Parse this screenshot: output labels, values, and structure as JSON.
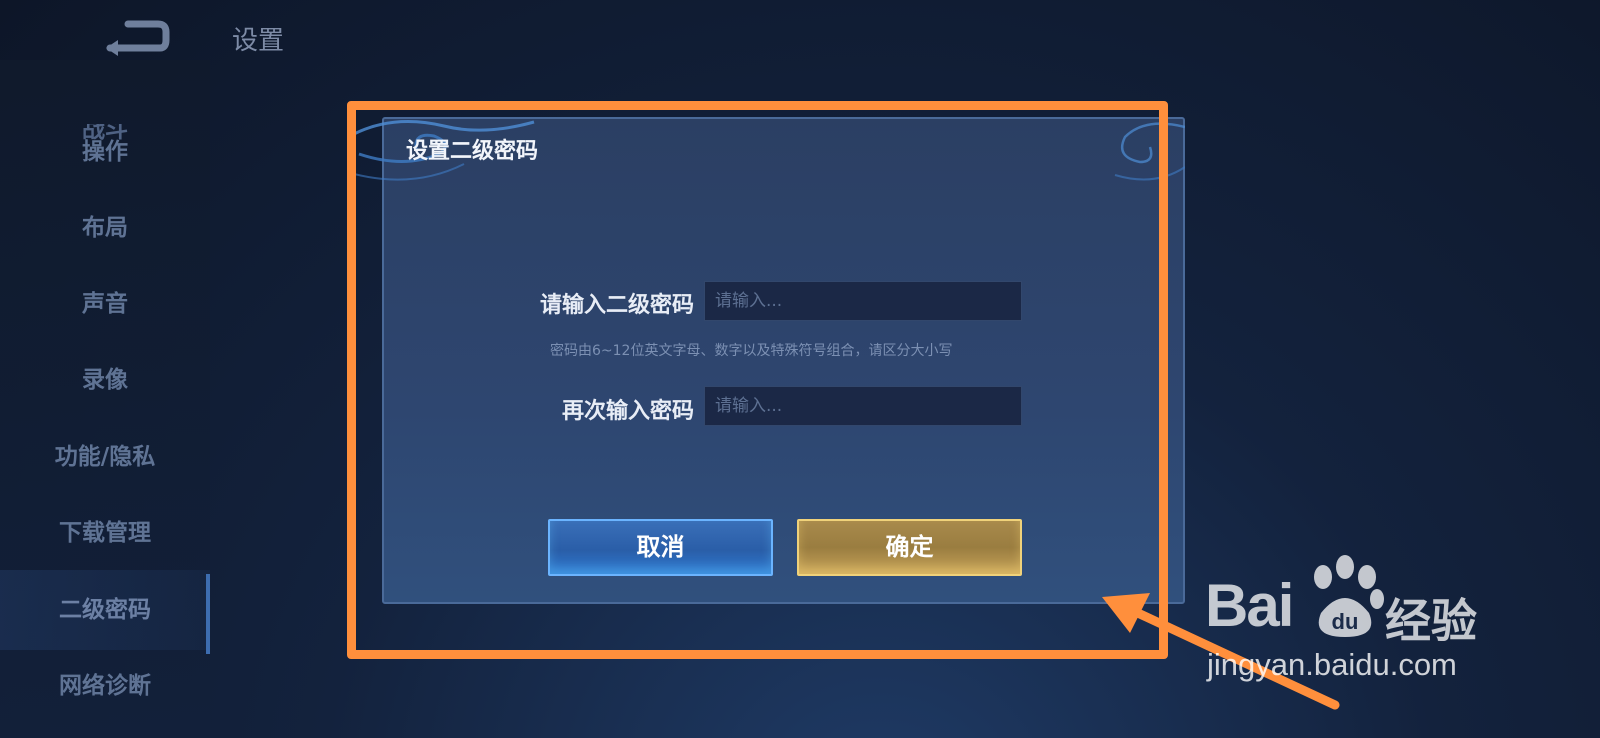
{
  "header": {
    "title": "设置"
  },
  "sidebar": {
    "cut_item": "战斗",
    "items": [
      {
        "label": "操作"
      },
      {
        "label": "布局"
      },
      {
        "label": "声音"
      },
      {
        "label": "录像"
      },
      {
        "label": "功能/隐私"
      },
      {
        "label": "下载管理"
      },
      {
        "label": "二级密码",
        "active": true
      },
      {
        "label": "网络诊断"
      }
    ]
  },
  "dialog": {
    "title": "设置二级密码",
    "password_label": "请输入二级密码",
    "password_placeholder": "请输入...",
    "hint": "密码由6~12位英文字母、数字以及特殊符号组合，请区分大小写",
    "confirm_label": "再次输入密码",
    "confirm_placeholder": "请输入...",
    "cancel_button": "取消",
    "ok_button": "确定"
  },
  "annotation": {
    "highlight_color": "#ff8f3c"
  },
  "watermark": {
    "logo_text": "Bai",
    "logo_du": "du",
    "jingyan": "经验",
    "url": "jingyan.baidu.com"
  },
  "colors": {
    "cancel_button": "#2f6cb8",
    "ok_button": "#b3924c",
    "dialog_bg": "#2e4670"
  }
}
